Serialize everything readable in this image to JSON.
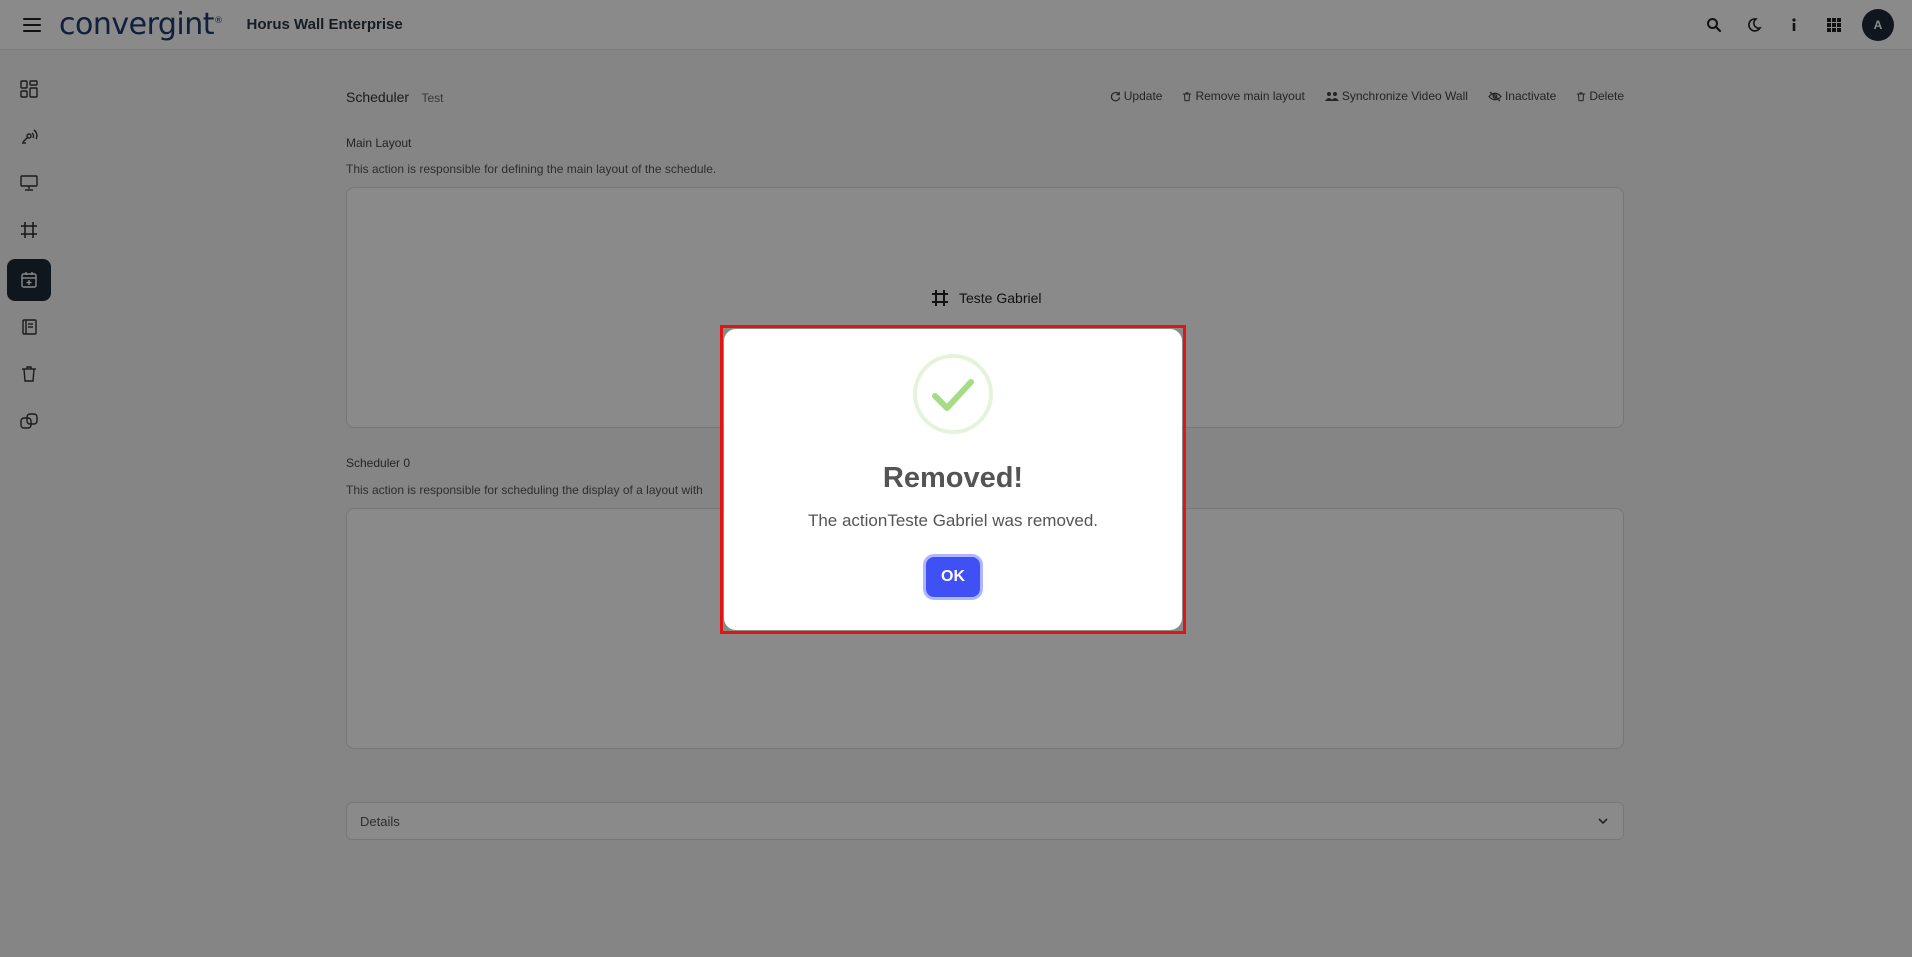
{
  "header": {
    "brand": "convergint",
    "brand_mark": "®",
    "app_title": "Horus Wall Enterprise",
    "avatar_initial": "A",
    "icons": [
      "menu-icon",
      "search-icon",
      "moon-icon",
      "info-icon",
      "apps-grid-icon"
    ]
  },
  "sidebar": {
    "items": [
      {
        "icon": "dashboard-icon",
        "active": false
      },
      {
        "icon": "broadcast-icon",
        "active": false
      },
      {
        "icon": "monitor-icon",
        "active": false
      },
      {
        "icon": "layout-frame-icon",
        "active": false
      },
      {
        "icon": "calendar-icon",
        "active": true
      },
      {
        "icon": "book-icon",
        "active": false
      },
      {
        "icon": "trash-icon",
        "active": false
      },
      {
        "icon": "link-icon",
        "active": false
      }
    ]
  },
  "page": {
    "title": "Scheduler",
    "subtitle": "Test",
    "actions": [
      {
        "label": "Update",
        "icon": "refresh-icon"
      },
      {
        "label": "Remove main layout",
        "icon": "trash-icon"
      },
      {
        "label": "Synchronize Video Wall",
        "icon": "users-icon"
      },
      {
        "label": "Inactivate",
        "icon": "eye-off-icon"
      },
      {
        "label": "Delete",
        "icon": "trash-icon"
      }
    ],
    "main_layout": {
      "title": "Main Layout",
      "description": "This action is responsible for defining the main layout of the schedule.",
      "layout_name": "Teste Gabriel"
    },
    "scheduler0": {
      "title": "Scheduler 0",
      "description": "This action is responsible for scheduling the display of a layout with"
    },
    "details_label": "Details"
  },
  "modal": {
    "title": "Removed!",
    "text": "The actionTeste Gabriel was removed.",
    "ok_label": "OK",
    "success_color": "#a5dc86",
    "button_color": "#3f51f5",
    "highlight_color": "#e31414"
  }
}
